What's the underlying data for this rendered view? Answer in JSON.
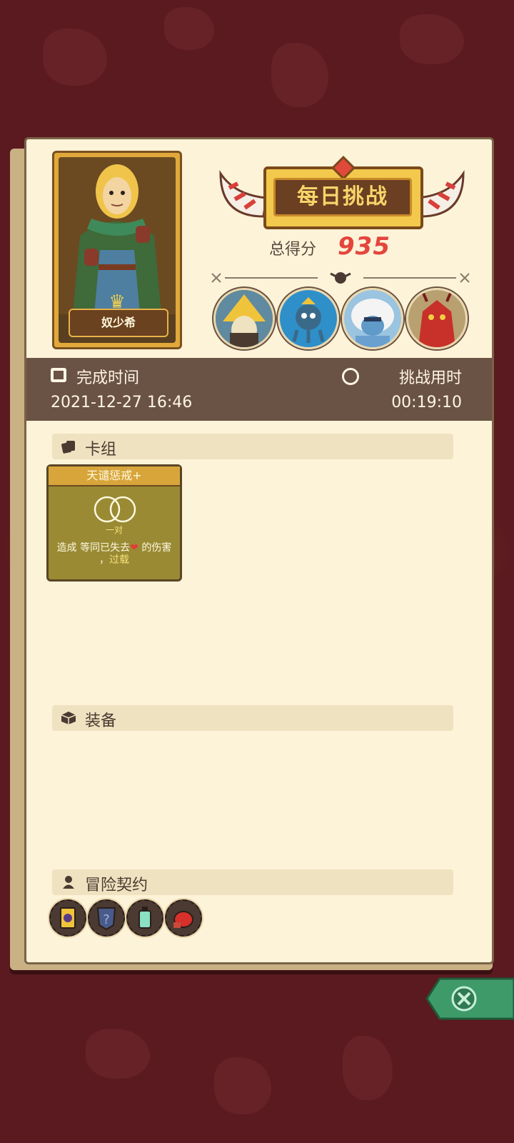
{
  "screen": {
    "hero_name": "奴少希",
    "banner_title": "每日挑战",
    "score_label": "总得分",
    "score_value": "935"
  },
  "info": {
    "completion_label": "完成时间",
    "completion_value": "2021-12-27 16:46",
    "duration_label": "挑战用时",
    "duration_value": "00:19:10"
  },
  "sections": {
    "deck": "卡组",
    "equipment": "装备",
    "contracts": "冒险契约"
  },
  "card": {
    "title": "天谴惩戒+",
    "tag": "一对",
    "desc_prefix": "造成 等同已失去",
    "desc_suffix": "的伤害",
    "desc_line2_prefix": "，",
    "desc_keyword": "过载"
  },
  "bosses": [
    "boss-wizard-icon",
    "boss-squid-icon",
    "boss-yeti-icon",
    "boss-dragon-icon"
  ],
  "contracts": [
    "contract-moon-card-icon",
    "contract-shield-question-icon",
    "contract-potion-icon",
    "contract-glove-icon"
  ],
  "colors": {
    "background": "#5a1a1f",
    "panel": "#fdf3d8",
    "info_bar": "#6a5245",
    "score": "#e4453d",
    "banner": "#f2c94c"
  }
}
